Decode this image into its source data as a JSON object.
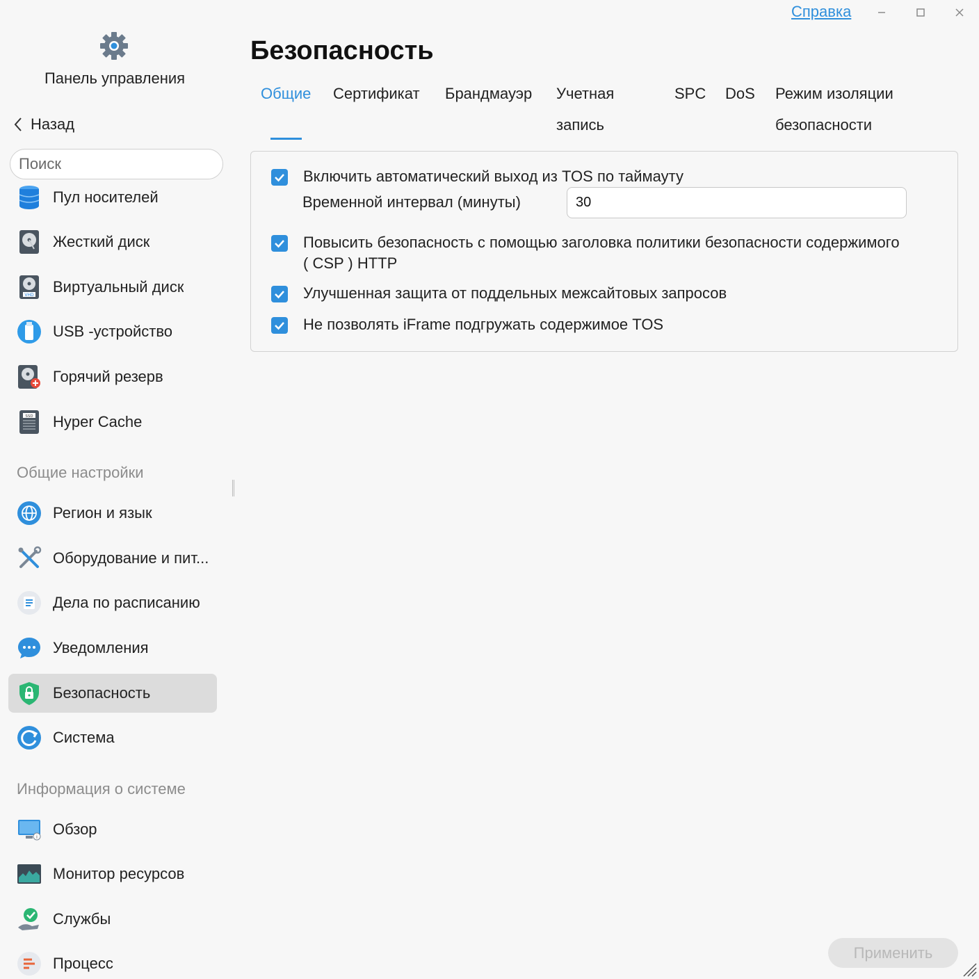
{
  "window": {
    "help_label": "Справка",
    "minimize_glyph": "−",
    "maximize_glyph": "☐",
    "close_glyph": "✕"
  },
  "sidebar": {
    "app_title": "Панель управления",
    "back_label": "Назад",
    "search_placeholder": "Поиск",
    "items": [
      {
        "label": "Пул носителей",
        "icon": "storage-pool-icon"
      },
      {
        "label": "Жесткий диск",
        "icon": "hard-disk-icon"
      },
      {
        "label": "Виртуальный диск",
        "icon": "virtual-disk-icon"
      },
      {
        "label": "USB -устройство",
        "icon": "usb-icon"
      },
      {
        "label": "Горячий резерв",
        "icon": "hot-spare-icon"
      },
      {
        "label": "Hyper Cache",
        "icon": "ssd-cache-icon"
      }
    ],
    "general_section": "Общие настройки",
    "general_items": [
      {
        "label": "Регион и язык",
        "icon": "globe-icon"
      },
      {
        "label": "Оборудование и пит...",
        "icon": "tools-icon"
      },
      {
        "label": "Дела по расписанию",
        "icon": "schedule-icon"
      },
      {
        "label": "Уведомления",
        "icon": "chat-bubble-icon"
      },
      {
        "label": "Безопасность",
        "icon": "shield-lock-icon",
        "active": true
      },
      {
        "label": "Система",
        "icon": "refresh-icon"
      }
    ],
    "info_section": "Информация о системе",
    "info_items": [
      {
        "label": "Обзор",
        "icon": "monitor-icon"
      },
      {
        "label": "Монитор ресурсов",
        "icon": "resource-chart-icon"
      },
      {
        "label": "Службы",
        "icon": "services-icon"
      },
      {
        "label": "Процесс",
        "icon": "process-icon"
      }
    ]
  },
  "main": {
    "title": "Безопасность",
    "tabs": [
      {
        "label": "Общие",
        "active": true
      },
      {
        "label": "Сертификат"
      },
      {
        "label": "Брандмауэр"
      },
      {
        "label_line1": "Учетная",
        "label_line2": "запись"
      },
      {
        "label": "SPC"
      },
      {
        "label": "DoS"
      },
      {
        "label_line1": "Режим изоляции",
        "label_line2": "безопасности"
      }
    ],
    "options": {
      "auto_logout": {
        "label": "Включить автоматический выход из TOS по таймауту",
        "checked": true
      },
      "interval_label": "Временной интервал (минуты)",
      "interval_value": "30",
      "csp": {
        "label_line1": "Повысить безопасность с помощью заголовка политики безопасности содержимого",
        "label_line2": "( CSP ) HTTP",
        "checked": true
      },
      "csrf": {
        "label": "Улучшенная защита от поддельных межсайтовых запросов",
        "checked": true
      },
      "iframe": {
        "label": "Не позволять iFrame подгружать содержимое TOS",
        "checked": true
      }
    },
    "apply_label": "Применить"
  },
  "colors": {
    "accent": "#2f8fdc",
    "background": "#f7f7f7",
    "active_item": "#dcdcdc"
  }
}
